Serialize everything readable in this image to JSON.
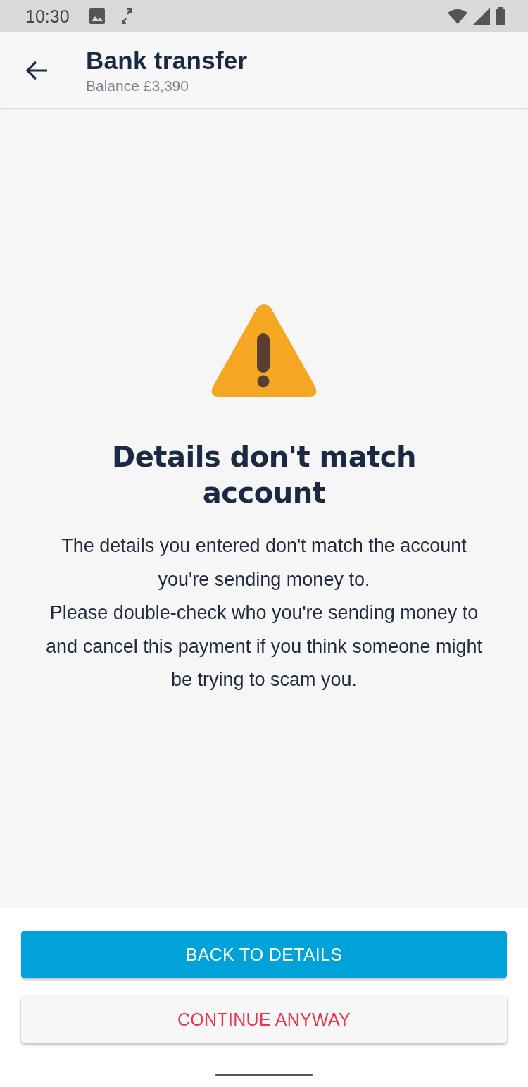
{
  "status_bar": {
    "time": "10:30"
  },
  "header": {
    "title": "Bank transfer",
    "subtitle": "Balance £3,390"
  },
  "warning": {
    "title": "Details don't match account",
    "paragraphs": [
      "The details you entered don't match the account you're sending money to.",
      "Please double-check who you're sending money to and cancel this payment if you think someone might be trying to scam you."
    ]
  },
  "buttons": [
    {
      "label": "BACK TO DETAILS",
      "kind": "primary"
    },
    {
      "label": "CONTINUE ANYWAY",
      "kind": "secondary"
    }
  ]
}
